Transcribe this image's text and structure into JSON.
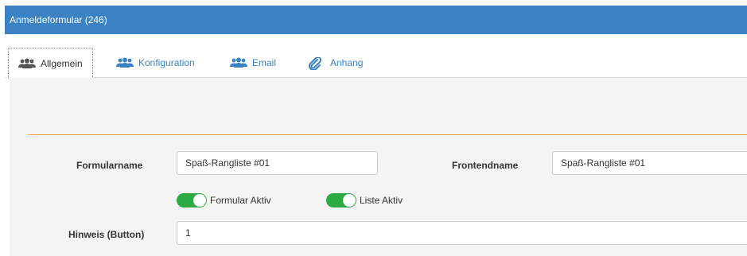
{
  "window": {
    "title": "Anmeldeformular (246)"
  },
  "tabs": [
    {
      "label": "Allgemein",
      "icon": "users-icon"
    },
    {
      "label": "Konfiguration",
      "icon": "users-icon"
    },
    {
      "label": "Email",
      "icon": "users-icon"
    },
    {
      "label": "Anhang",
      "icon": "paperclip-icon"
    }
  ],
  "form": {
    "formularname_label": "Formularname",
    "formularname_value": "Spaß-Rangliste #01",
    "frontendname_label": "Frontendname",
    "frontendname_value": "Spaß-Rangliste #01",
    "toggle_formular_aktiv": "Formular Aktiv",
    "toggle_liste_aktiv": "Liste Aktiv",
    "hinweis_label": "Hinweis (Button)",
    "hinweis_value": "1"
  },
  "colors": {
    "accent": "#3b82c4",
    "toggle_on": "#2eaa44",
    "separator": "#f0a458"
  }
}
